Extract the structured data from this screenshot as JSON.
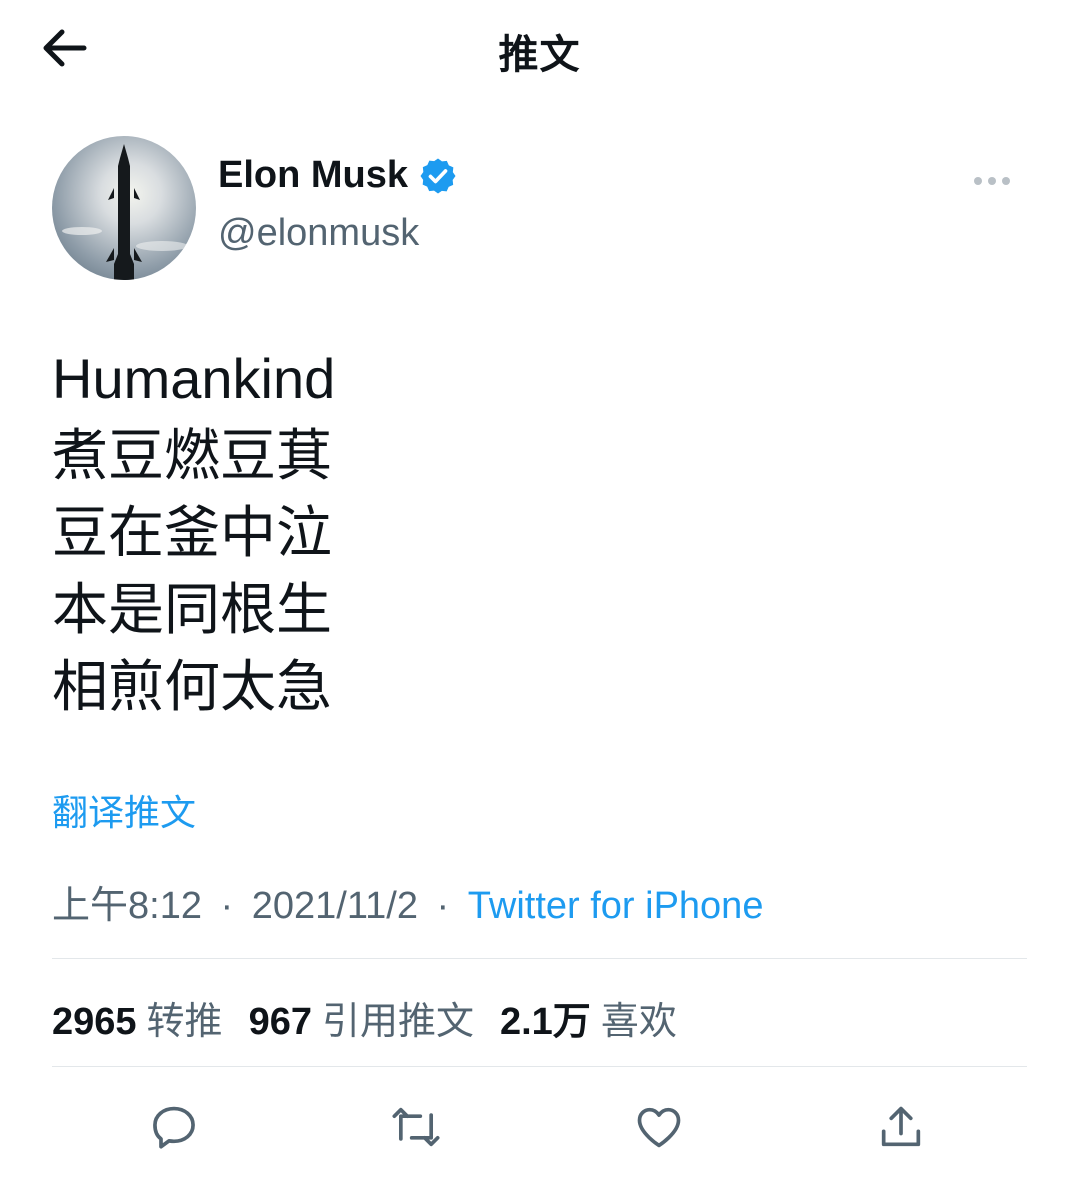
{
  "header": {
    "title": "推文"
  },
  "author": {
    "display_name": "Elon Musk",
    "handle": "@elonmusk",
    "verified": true
  },
  "tweet": {
    "lines": [
      "Humankind",
      "煮豆燃豆萁",
      "豆在釜中泣",
      "本是同根生",
      "相煎何太急"
    ],
    "translate_label": "翻译推文"
  },
  "meta": {
    "time": "上午8:12",
    "date": "2021/11/2",
    "separator": "·",
    "source": "Twitter for iPhone"
  },
  "stats": {
    "retweets": {
      "count": "2965",
      "label": "转推"
    },
    "quotes": {
      "count": "967",
      "label": "引用推文"
    },
    "likes": {
      "count": "2.1万",
      "label": "喜欢"
    }
  },
  "icons": {
    "back": "arrow-left-icon",
    "verified": "verified-badge-icon",
    "more": "more-dots-icon",
    "reply": "reply-icon",
    "retweet": "retweet-icon",
    "like": "heart-icon",
    "share": "share-icon"
  },
  "colors": {
    "accent": "#1d9bf0",
    "text_primary": "#0f1419",
    "text_secondary": "#536471",
    "divider": "#e3e7ea"
  }
}
